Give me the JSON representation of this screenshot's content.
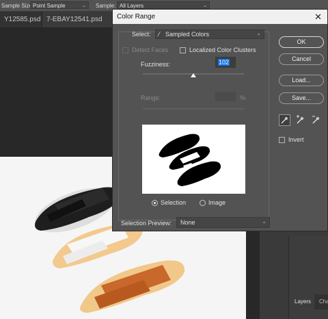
{
  "options_bar": {
    "sample_size_label": "Sample Size:",
    "sample_size_value": "Point Sample",
    "sample_label": "Sample:",
    "sample_value": "All Layers"
  },
  "tabs": [
    {
      "label": "Y12585.psd"
    },
    {
      "label": "7-EBAY12541.psd"
    }
  ],
  "tab_close_glyph": "×",
  "dialog": {
    "title": "Color Range",
    "close_glyph": "✕",
    "select_label": "Select:",
    "select_value": "Sampled Colors",
    "detect_faces_label": "Detect Faces",
    "localized_label": "Localized Color Clusters",
    "fuzziness_label": "Fuzziness:",
    "fuzziness_value": "102",
    "range_label": "Range:",
    "range_unit": "%",
    "selection_label": "Selection",
    "image_label": "Image",
    "preview_label": "Selection Preview:",
    "preview_value": "None",
    "buttons": {
      "ok": "OK",
      "cancel": "Cancel",
      "load": "Load...",
      "save": "Save..."
    },
    "invert_label": "Invert",
    "view_mode": "Selection"
  },
  "panels": {
    "layers_tab": "Layers",
    "second_tab": "Cha"
  },
  "colors": {
    "accent": "#1473e6",
    "dialog_bg": "#535353",
    "canvas_bg": "#f4f4f4"
  }
}
